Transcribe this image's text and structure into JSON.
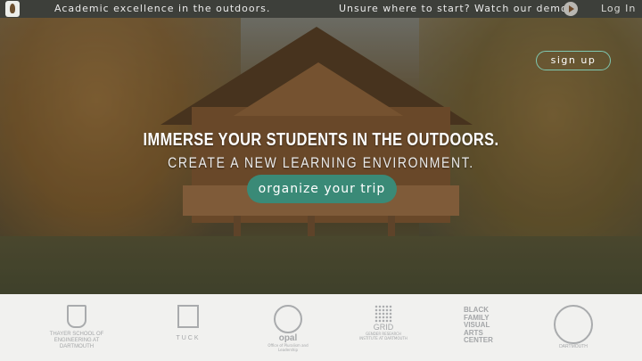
{
  "topbar": {
    "tagline": "Academic excellence in the outdoors.",
    "demo_prompt": "Unsure where to start? Watch our demo!",
    "login_label": "Log In"
  },
  "hero": {
    "signup_label": "sign up",
    "headline": "IMMERSE YOUR STUDENTS IN THE OUTDOORS.",
    "subheadline": "CREATE A NEW LEARNING ENVIRONMENT.",
    "cta_label": "organize your trip"
  },
  "partners": {
    "thayer": {
      "name": "THAYER SCHOOL OF ENGINEERING AT DARTMOUTH"
    },
    "tuck": {
      "name": "TUCK"
    },
    "opal": {
      "name": "opal",
      "sub": "Office of Pluralism and Leadership"
    },
    "grid": {
      "name": "GRID",
      "sub": "GENDER RESEARCH INSTITUTE AT DARTMOUTH"
    },
    "black_family": {
      "line1": "BLACK",
      "line2": "FAMILY",
      "line3": "VISUAL",
      "line4": "ARTS",
      "line5": "CENTER"
    },
    "dartmouth": {
      "name": "DARTMOUTH"
    }
  },
  "colors": {
    "accent": "#3a8a77",
    "topbar": "#3d3f3a"
  }
}
